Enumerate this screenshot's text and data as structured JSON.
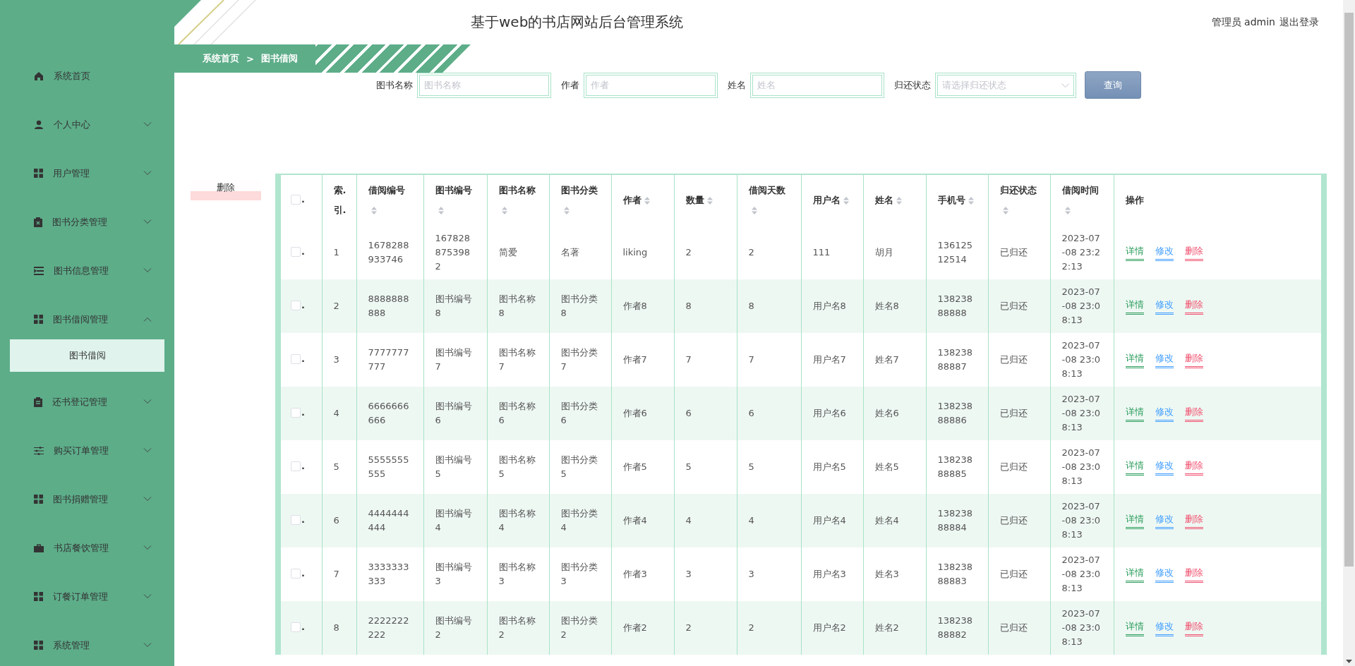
{
  "sidebar": {
    "items": [
      {
        "label": "系统首页",
        "kind": "link"
      },
      {
        "label": "个人中心",
        "kind": "menu",
        "expanded": false
      },
      {
        "label": "用户管理",
        "kind": "menu",
        "expanded": false
      },
      {
        "label": "图书分类管理",
        "kind": "menu",
        "expanded": false
      },
      {
        "label": "图书信息管理",
        "kind": "menu",
        "expanded": false
      },
      {
        "label": "图书借阅管理",
        "kind": "menu",
        "expanded": true,
        "children": [
          {
            "label": "图书借阅",
            "selected": true
          }
        ]
      },
      {
        "label": "还书登记管理",
        "kind": "menu",
        "expanded": false
      },
      {
        "label": "购买订单管理",
        "kind": "menu",
        "expanded": false
      },
      {
        "label": "图书捐赠管理",
        "kind": "menu",
        "expanded": false
      },
      {
        "label": "书店餐饮管理",
        "kind": "menu",
        "expanded": false
      },
      {
        "label": "订餐订单管理",
        "kind": "menu",
        "expanded": false
      },
      {
        "label": "系统管理",
        "kind": "menu",
        "expanded": false
      }
    ]
  },
  "header": {
    "title": "基于web的书店网站后台管理系统",
    "user": "管理员 admin",
    "logout": "退出登录"
  },
  "breadcrumb": {
    "home": "系统首页",
    "separator": ">",
    "current": "图书借阅"
  },
  "search": {
    "fields": [
      {
        "label": "图书名称",
        "placeholder": "图书名称",
        "kind": "input"
      },
      {
        "label": "作者",
        "placeholder": "作者",
        "kind": "input"
      },
      {
        "label": "姓名",
        "placeholder": "姓名",
        "kind": "input"
      },
      {
        "label": "归还状态",
        "placeholder": "请选择归还状态",
        "kind": "select"
      }
    ],
    "button": "查询"
  },
  "delete_button": "删除",
  "table": {
    "select_all": {
      "checked": false,
      "label": "."
    },
    "columns": [
      {
        "label": "索.引.",
        "sortable": false
      },
      {
        "label": "借阅编号",
        "sortable": true
      },
      {
        "label": "图书编号",
        "sortable": true
      },
      {
        "label": "图书名称",
        "sortable": true
      },
      {
        "label": "图书分类",
        "sortable": true
      },
      {
        "label": "作者",
        "sortable": true
      },
      {
        "label": "数量",
        "sortable": true
      },
      {
        "label": "借阅天数",
        "sortable": true
      },
      {
        "label": "用户名",
        "sortable": true
      },
      {
        "label": "姓名",
        "sortable": true
      },
      {
        "label": "手机号",
        "sortable": true
      },
      {
        "label": "归还状态",
        "sortable": true
      },
      {
        "label": "借阅时间",
        "sortable": true
      },
      {
        "label": "操作",
        "sortable": false
      }
    ],
    "rows": [
      {
        "checked": false,
        "mark": ".",
        "cells": [
          "1",
          "1678288933746",
          "1678288753982",
          "简爱",
          "名著",
          "liking",
          "2",
          "2",
          "111",
          "胡月",
          "13612512514",
          "已归还",
          "2023-07-08 23:22:13"
        ],
        "actions": [
          {
            "label": "详情",
            "color": "#2e9e5e"
          },
          {
            "label": "修改",
            "color": "#409eff"
          },
          {
            "label": "删除",
            "color": "#f0506e"
          }
        ]
      },
      {
        "checked": false,
        "mark": ".",
        "cells": [
          "2",
          "8888888888",
          "图书编号8",
          "图书名称8",
          "图书分类8",
          "作者8",
          "8",
          "8",
          "用户名8",
          "姓名8",
          "13823888888",
          "已归还",
          "2023-07-08 23:08:13"
        ],
        "actions": [
          {
            "label": "详情",
            "color": "#2e9e5e"
          },
          {
            "label": "修改",
            "color": "#409eff"
          },
          {
            "label": "删除",
            "color": "#f0506e"
          }
        ]
      },
      {
        "checked": false,
        "mark": ".",
        "cells": [
          "3",
          "7777777777",
          "图书编号7",
          "图书名称7",
          "图书分类7",
          "作者7",
          "7",
          "7",
          "用户名7",
          "姓名7",
          "13823888887",
          "已归还",
          "2023-07-08 23:08:13"
        ],
        "actions": [
          {
            "label": "详情",
            "color": "#2e9e5e"
          },
          {
            "label": "修改",
            "color": "#409eff"
          },
          {
            "label": "删除",
            "color": "#f0506e"
          }
        ]
      },
      {
        "checked": false,
        "mark": ".",
        "cells": [
          "4",
          "6666666666",
          "图书编号6",
          "图书名称6",
          "图书分类6",
          "作者6",
          "6",
          "6",
          "用户名6",
          "姓名6",
          "13823888886",
          "已归还",
          "2023-07-08 23:08:13"
        ],
        "actions": [
          {
            "label": "详情",
            "color": "#2e9e5e"
          },
          {
            "label": "修改",
            "color": "#409eff"
          },
          {
            "label": "删除",
            "color": "#f0506e"
          }
        ]
      },
      {
        "checked": false,
        "mark": ".",
        "cells": [
          "5",
          "5555555555",
          "图书编号5",
          "图书名称5",
          "图书分类5",
          "作者5",
          "5",
          "5",
          "用户名5",
          "姓名5",
          "13823888885",
          "已归还",
          "2023-07-08 23:08:13"
        ],
        "actions": [
          {
            "label": "详情",
            "color": "#2e9e5e"
          },
          {
            "label": "修改",
            "color": "#409eff"
          },
          {
            "label": "删除",
            "color": "#f0506e"
          }
        ]
      },
      {
        "checked": false,
        "mark": ".",
        "cells": [
          "6",
          "4444444444",
          "图书编号4",
          "图书名称4",
          "图书分类4",
          "作者4",
          "4",
          "4",
          "用户名4",
          "姓名4",
          "13823888884",
          "已归还",
          "2023-07-08 23:08:13"
        ],
        "actions": [
          {
            "label": "详情",
            "color": "#2e9e5e"
          },
          {
            "label": "修改",
            "color": "#409eff"
          },
          {
            "label": "删除",
            "color": "#f0506e"
          }
        ]
      },
      {
        "checked": false,
        "mark": ".",
        "cells": [
          "7",
          "3333333333",
          "图书编号3",
          "图书名称3",
          "图书分类3",
          "作者3",
          "3",
          "3",
          "用户名3",
          "姓名3",
          "13823888883",
          "已归还",
          "2023-07-08 23:08:13"
        ],
        "actions": [
          {
            "label": "详情",
            "color": "#2e9e5e"
          },
          {
            "label": "修改",
            "color": "#409eff"
          },
          {
            "label": "删除",
            "color": "#f0506e"
          }
        ]
      },
      {
        "checked": false,
        "mark": ".",
        "cells": [
          "8",
          "2222222222",
          "图书编号2",
          "图书名称2",
          "图书分类2",
          "作者2",
          "2",
          "2",
          "用户名2",
          "姓名2",
          "13823888882",
          "已归还",
          "2023-07-08 23:08:13"
        ],
        "actions": [
          {
            "label": "详情",
            "color": "#2e9e5e"
          },
          {
            "label": "修改",
            "color": "#409eff"
          },
          {
            "label": "删除",
            "color": "#f0506e"
          }
        ]
      }
    ]
  }
}
